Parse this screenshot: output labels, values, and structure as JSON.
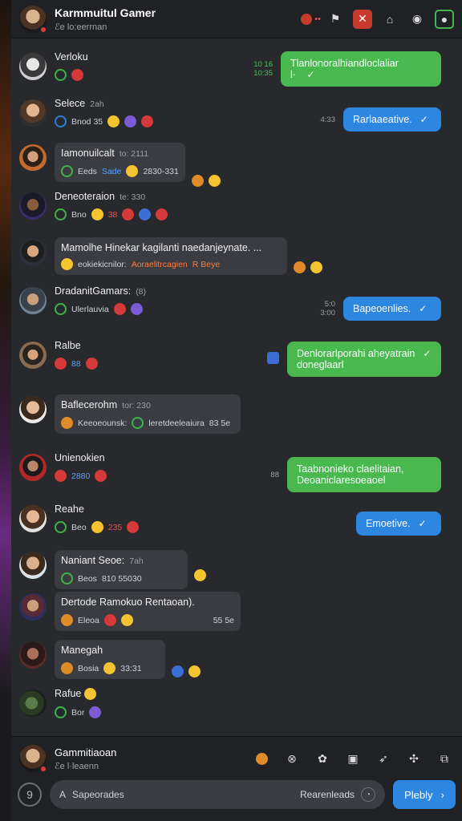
{
  "header": {
    "title": "Karmmuitul Gamer",
    "subtitle": "ℰe lo:eerrnan",
    "icons": [
      "alert-icon",
      "flag-icon",
      "house-icon",
      "camera-icon",
      "profile-icon"
    ]
  },
  "messages": [
    {
      "name": "Verloku",
      "meta": "",
      "reacts": ""
    },
    {
      "name": "Selece",
      "meta": "2ah",
      "reacts": "Bnod  35",
      "reacts2": ""
    },
    {
      "name": "Iamonuilcalt",
      "meta": "to: 2111",
      "reacts": "Eeds",
      "tag": "Sade",
      "reacts2": "2830-331"
    },
    {
      "name": "Deneoteraion",
      "meta": "te: 330",
      "reacts": "Bno",
      "reacts2": "38"
    },
    {
      "name": "Mamolhe Hinekar kagilanti naedanjeynate. ...",
      "line2": "eokiekicnilor:",
      "line2b": "Aoraelitrcagien",
      "line2c": "R Beye"
    },
    {
      "name": "DradanitGamars:",
      "meta": "(8)",
      "reacts": "Ulerlauvia"
    },
    {
      "name": "Ralbe",
      "meta": "",
      "reacts": "88"
    },
    {
      "name": "Baflecerohm",
      "meta": "tor: 230",
      "line2": "Keeoeounsk:",
      "line2b": "leretdeeleaiura",
      "line2c": "83 5e"
    },
    {
      "name": "Unienokien",
      "meta": "",
      "reacts": "2880"
    },
    {
      "name": "Reahe",
      "meta": "",
      "reacts": "Beo",
      "reacts2": "235"
    },
    {
      "name": "Naniant Seoe:",
      "meta": "7ah",
      "reacts": "Beos",
      "reacts2": "810  55030"
    },
    {
      "name": "Dertode Ramokuo Rentaoan).",
      "reacts": "Eleoa",
      "tail": "55 5e"
    },
    {
      "name": "Manegah",
      "meta": "",
      "reacts": "Bosia",
      "reacts2": "33:31"
    },
    {
      "name": "Rafue",
      "meta": "",
      "reacts": "Bor"
    }
  ],
  "outgoing": [
    {
      "text": "Tlanlonoralhiandloclaliar",
      "extra": "l·",
      "time": "10 16\n10:35"
    },
    {
      "text": "Rarlaaeative.",
      "time": "4:33"
    },
    {
      "text": "Bapeoenlies.",
      "time": "5:0\n3:00"
    },
    {
      "text": "Denlorarlporahi aheyatrain",
      "text2": "doneglaarl",
      "time": ""
    },
    {
      "text": "Taabnonieko claelitaian,",
      "text2": "Deoaniclaresoeaoel",
      "time": "88"
    },
    {
      "text": "Emoetive.",
      "time": ""
    }
  ],
  "footer": {
    "name": "Gammitiaoan",
    "sub": "ℰe l·leaenn",
    "search_placeholder": "Sapeorades",
    "search_right": "Rearenleads",
    "send_label": "Plebly"
  }
}
